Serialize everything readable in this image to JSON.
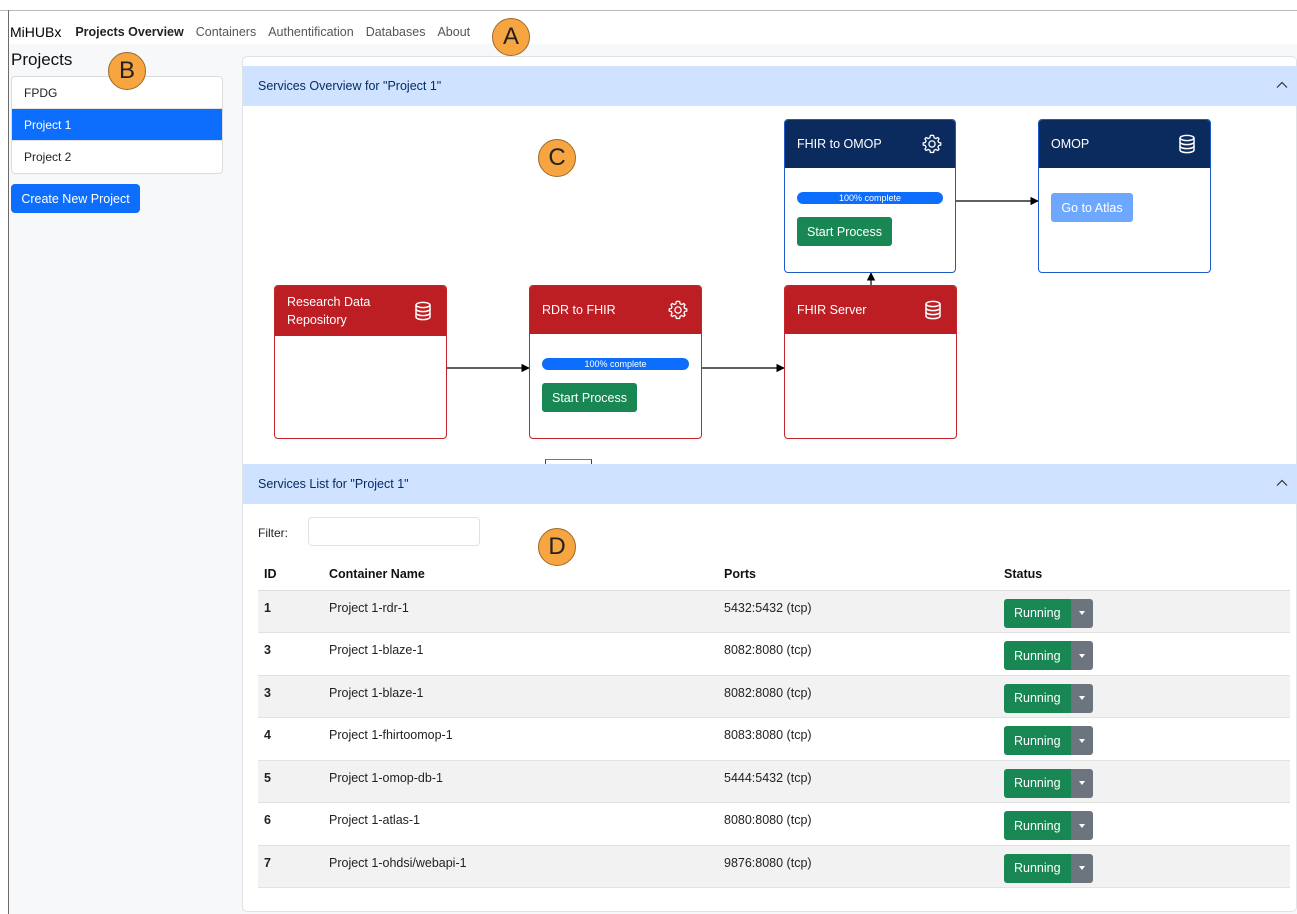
{
  "navbar": {
    "brand": "MiHUBx",
    "links": [
      "Projects Overview",
      "Containers",
      "Authentification",
      "Databases",
      "About"
    ]
  },
  "markers": [
    "A",
    "B",
    "C",
    "D"
  ],
  "sidebar": {
    "title": "Projects",
    "projects": [
      "FPDG",
      "Project 1",
      "Project 2"
    ],
    "selected": "Project 1",
    "create_button": "Create New Project"
  },
  "overview": {
    "title": "Services Overview for \"Project 1\"",
    "cards": {
      "rdr": {
        "title": "Research Data Repository",
        "icon": "database-icon"
      },
      "rdr_to_fhir": {
        "title": "RDR to FHIR",
        "icon": "gear-icon",
        "progress": "100% complete",
        "progress_value": 100,
        "button": "Start Process"
      },
      "fhir_server": {
        "title": "FHIR Server",
        "icon": "database-icon"
      },
      "fhir_to_omop": {
        "title": "FHIR to OMOP",
        "icon": "gear-icon",
        "progress": "100% complete",
        "progress_value": 100,
        "button": "Start Process"
      },
      "omop": {
        "title": "OMOP",
        "icon": "database-icon",
        "button": "Go to Atlas"
      }
    }
  },
  "services_list": {
    "title": "Services List for \"Project 1\"",
    "filter_label": "Filter:",
    "filter_value": "",
    "columns": [
      "ID",
      "Container Name",
      "Ports",
      "Status"
    ],
    "rows": [
      {
        "id": "1",
        "name": "Project 1-rdr-1",
        "ports": "5432:5432 (tcp)",
        "status": "Running"
      },
      {
        "id": "3",
        "name": "Project 1-blaze-1",
        "ports": "8082:8080 (tcp)",
        "status": "Running"
      },
      {
        "id": "3",
        "name": "Project 1-blaze-1",
        "ports": "8082:8080 (tcp)",
        "status": "Running"
      },
      {
        "id": "4",
        "name": "Project 1-fhirtoomop-1",
        "ports": "8083:8080 (tcp)",
        "status": "Running"
      },
      {
        "id": "5",
        "name": "Project 1-omop-db-1",
        "ports": "5444:5432 (tcp)",
        "status": "Running"
      },
      {
        "id": "6",
        "name": "Project 1-atlas-1",
        "ports": "8080:8080 (tcp)",
        "status": "Running"
      },
      {
        "id": "7",
        "name": "Project 1-ohdsi/webapi-1",
        "ports": "9876:8080 (tcp)",
        "status": "Running"
      }
    ]
  },
  "colors": {
    "primary": "#0d6efd",
    "success": "#198754",
    "card_red": "#bc1e24",
    "card_navy": "#0b2b5e",
    "accordion": "#cfe2ff",
    "marker": "#f7a541"
  }
}
